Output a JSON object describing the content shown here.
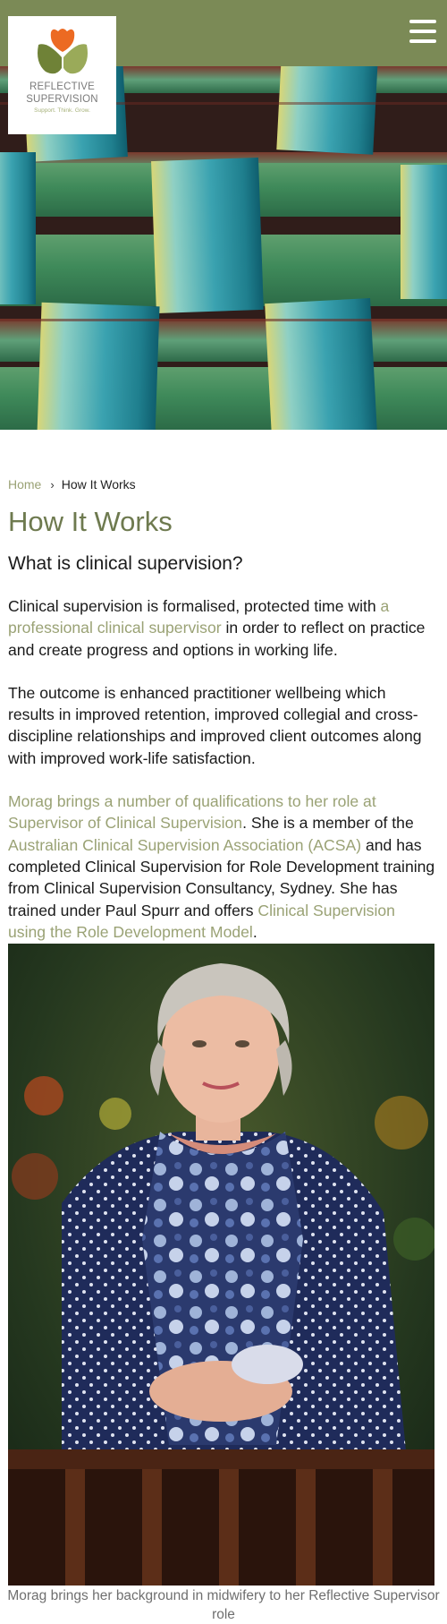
{
  "header": {
    "logo": {
      "line1": "REFLECTIVE",
      "line2": "SUPERVISION",
      "tagline": "Support. Think. Grow."
    },
    "menu_icon": "hamburger-menu-icon"
  },
  "hero": {
    "image": "woven green and teal flax leaves"
  },
  "breadcrumb": {
    "home": "Home",
    "separator": "›",
    "current": "How It Works"
  },
  "page_title": "How It Works",
  "section_heading": "What is clinical supervision?",
  "paragraphs": {
    "p1": {
      "a": "Clinical supervision is formalised, protected time with ",
      "link": "a professional clinical supervisor",
      "b": " in order to reflect on practice and create progress and options in working life."
    },
    "p2": "The outcome is enhanced practitioner wellbeing which results in improved retention, improved collegial and cross-discipline relationships and improved client outcomes along with improved work-life satisfaction.",
    "p3": {
      "link1": "Morag brings a number of qualifications to her role at Supervisor of Clinical Supervision",
      "a": ". She is a member of the ",
      "link2": "Australian Clinical Supervision Association (ACSA)",
      "b": " and has completed Clinical Supervision for Role Development training from Clinical Supervision Consultancy, Sydney. She has trained under Paul Spurr and offers ",
      "link3": "Clinical Supervision using the Role Development Model",
      "c": "."
    }
  },
  "photo": {
    "alt": "Morag portrait",
    "caption": "Morag brings her background in midwifery to her Reflective Supervisor role"
  },
  "colors": {
    "header": "#7b8a56",
    "accent": "#9aa275",
    "title": "#6e7a4f"
  }
}
